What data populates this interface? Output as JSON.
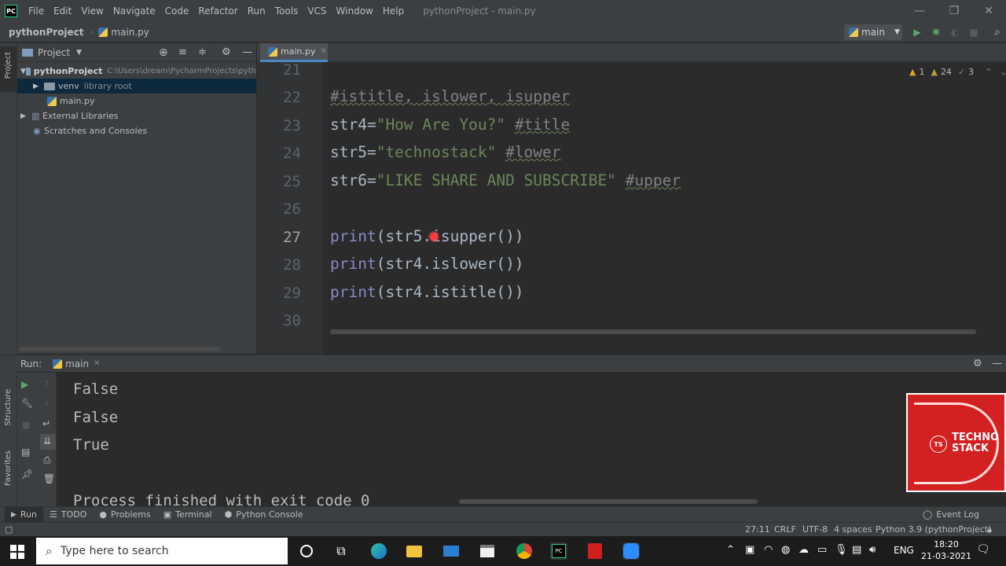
{
  "app": {
    "logo": "PC",
    "window_title": "pythonProject - main.py"
  },
  "menu": [
    "File",
    "Edit",
    "View",
    "Navigate",
    "Code",
    "Refactor",
    "Run",
    "Tools",
    "VCS",
    "Window",
    "Help"
  ],
  "breadcrumb": {
    "project": "pythonProject",
    "file": "main.py"
  },
  "run_config": {
    "name": "main"
  },
  "project_panel": {
    "title": "Project",
    "tree": [
      {
        "label": "pythonProject",
        "hint": "C:\\Users\\dream\\PycharmProjects\\pyth"
      },
      {
        "label": "venv",
        "hint": "library root"
      },
      {
        "label": "main.py",
        "hint": ""
      },
      {
        "label": "External Libraries",
        "hint": ""
      },
      {
        "label": "Scratches and Consoles",
        "hint": ""
      }
    ]
  },
  "editor": {
    "tab": "main.py",
    "inspections": {
      "warnings": "1",
      "weak": "24",
      "typos": "3"
    },
    "lines": [
      {
        "num": "21"
      },
      {
        "num": "22",
        "comment": "#istitle, islower, isupper"
      },
      {
        "num": "23",
        "var": "str4=",
        "str": "\"How Are You?\"",
        "comment": "#title"
      },
      {
        "num": "24",
        "var": "str5=",
        "str": "\"technostack\"",
        "comment": "#lower"
      },
      {
        "num": "25",
        "var": "str6=",
        "str": "\"LIKE SHARE AND SUBSCRIBE\"",
        "comment": "#upper"
      },
      {
        "num": "26"
      },
      {
        "num": "27",
        "fn": "print",
        "rest": "(str5.isupper())"
      },
      {
        "num": "28",
        "fn": "print",
        "rest": "(str4.islower())"
      },
      {
        "num": "29",
        "fn": "print",
        "rest": "(str4.istitle())"
      },
      {
        "num": "30"
      }
    ]
  },
  "run_panel": {
    "label": "Run:",
    "tab": "main",
    "output": [
      "False",
      "False",
      "True",
      "",
      "Process finished with exit code 0"
    ]
  },
  "bottom_tabs": [
    "Run",
    "TODO",
    "Problems",
    "Terminal",
    "Python Console"
  ],
  "event_log": "Event Log",
  "status": {
    "position": "27:11",
    "line_sep": "CRLF",
    "encoding": "UTF-8",
    "indent": "4 spaces",
    "interpreter": "Python 3.9 (pythonProject)"
  },
  "left_tabs": {
    "project": "Project",
    "structure": "Structure",
    "favorites": "Favorites"
  },
  "taskbar": {
    "search_placeholder": "Type here to search",
    "lang": "ENG",
    "time": "18:20",
    "date": "21-03-2021"
  },
  "watermark": {
    "badge": "TS",
    "line1": "TECHNO",
    "line2": "STACK"
  }
}
